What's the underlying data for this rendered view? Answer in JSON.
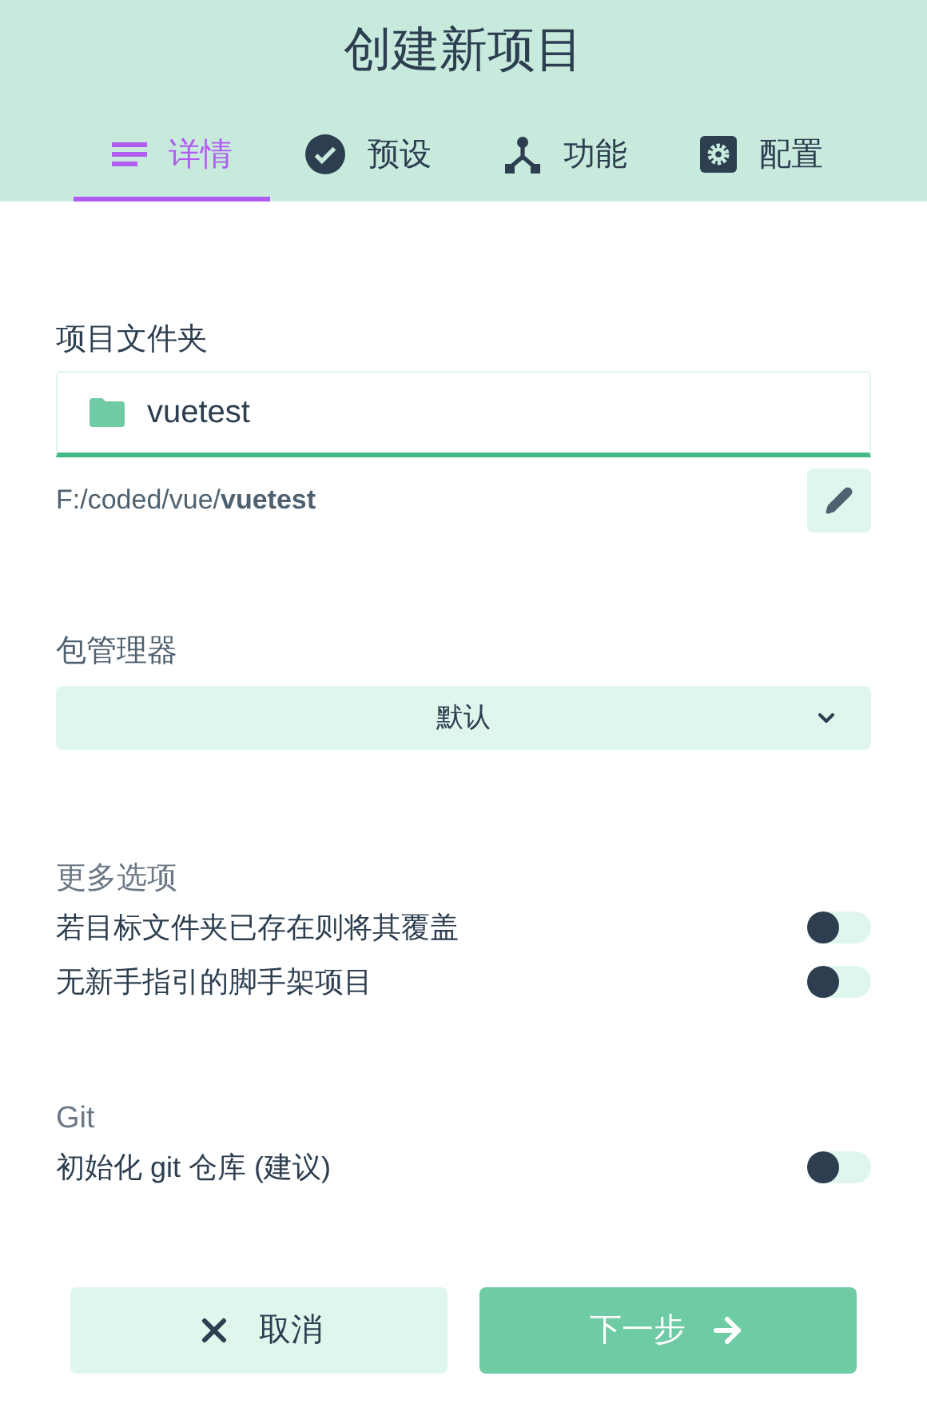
{
  "title": "创建新项目",
  "tabs": [
    {
      "label": "详情",
      "kind": "details",
      "selected": true
    },
    {
      "label": "预设",
      "kind": "presets",
      "selected": false
    },
    {
      "label": "功能",
      "kind": "features",
      "selected": false
    },
    {
      "label": "配置",
      "kind": "config",
      "selected": false
    }
  ],
  "folder": {
    "label": "项目文件夹",
    "value": "vuetest",
    "path": "F:/coded/vue/**vuetest**"
  },
  "package_manager": {
    "label": "包管理器",
    "value": "默认"
  },
  "more_options": {
    "label": "更多选项",
    "toggles": [
      {
        "label": "若目标文件夹已存在则将其覆盖",
        "on": false
      },
      {
        "label": "无新手指引的脚手架项目",
        "on": false
      }
    ]
  },
  "git": {
    "label": "Git",
    "toggles": [
      {
        "label": "初始化 git 仓库 (建议)",
        "on": false
      }
    ]
  },
  "buttons": [
    {
      "label": "取消",
      "kind": "cancel"
    },
    {
      "label": "下一步",
      "kind": "next"
    }
  ]
}
